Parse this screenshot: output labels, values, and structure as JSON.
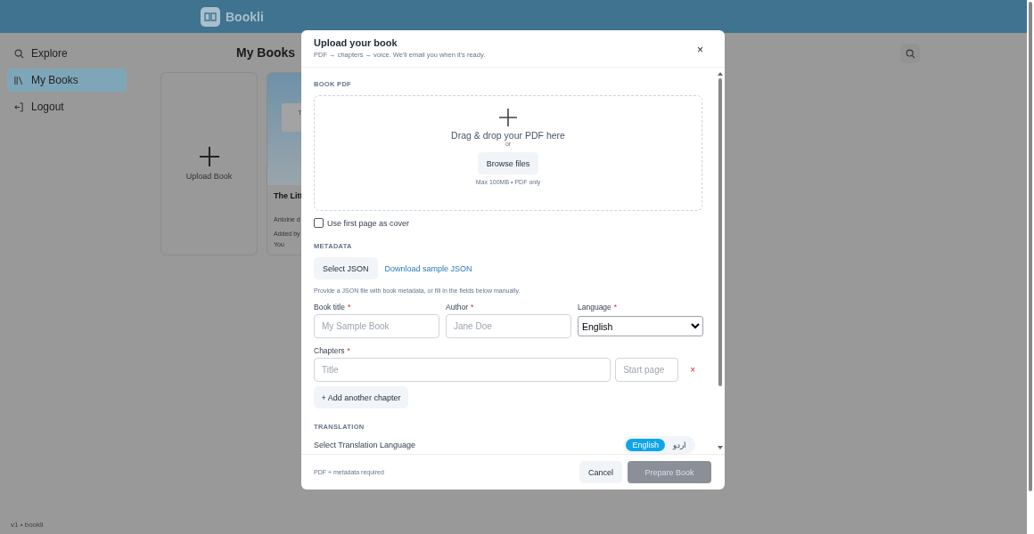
{
  "app": {
    "brand": "Bookli"
  },
  "sidebar": {
    "items": [
      {
        "label": "Explore",
        "selected": false
      },
      {
        "label": "My Books",
        "selected": true
      },
      {
        "label": "Logout",
        "selected": false
      }
    ],
    "footer": "v1 • bookli"
  },
  "page": {
    "title": "My Books",
    "upload_card": {
      "label": "Upload Book"
    },
    "books": [
      {
        "cover_text": "T",
        "title": "The Litt",
        "author": "Antoine d",
        "added_by_label": "Added by",
        "added_by": "You"
      }
    ]
  },
  "dialog": {
    "title": "Upload your book",
    "subtitle": "PDF → chapters → voice. We'll email you when it's ready.",
    "pdf_section": {
      "heading": "BOOK PDF",
      "drop_text": "Drag & drop your PDF here",
      "or": "or",
      "browse": "Browse files",
      "hint": "Max 100MB • PDF only",
      "cover_checkbox": {
        "label": "Use first page as cover",
        "checked": false
      }
    },
    "metadata": {
      "heading": "METADATA",
      "select_json": "Select JSON",
      "download_link": "Download sample JSON",
      "help": "Provide a JSON file with book metadata, or fill in the fields below manually.",
      "fields": [
        {
          "label": "Book title",
          "required_mark": "*",
          "kind": "text",
          "placeholder": "My Sample Book"
        },
        {
          "label": "Author",
          "required_mark": "*",
          "kind": "text",
          "placeholder": "Jane Doe"
        },
        {
          "label": "Language",
          "required_mark": "*",
          "kind": "select",
          "value": "English"
        }
      ],
      "chapters": {
        "label": "Chapters",
        "required_mark": "*",
        "rows": [
          {
            "title_placeholder": "Title",
            "page_placeholder": "Start page",
            "remove": "×"
          }
        ],
        "add": "+ Add another chapter"
      }
    },
    "translation": {
      "heading": "TRANSLATION",
      "label": "Select Translation Language",
      "options": [
        {
          "label": "English",
          "selected": true
        },
        {
          "label": "اردو",
          "selected": false
        }
      ]
    },
    "footer_note": "PDF + metadata required",
    "cancel": "Cancel",
    "submit": {
      "label": "Prepare Book",
      "disabled": true
    },
    "close": "×"
  }
}
